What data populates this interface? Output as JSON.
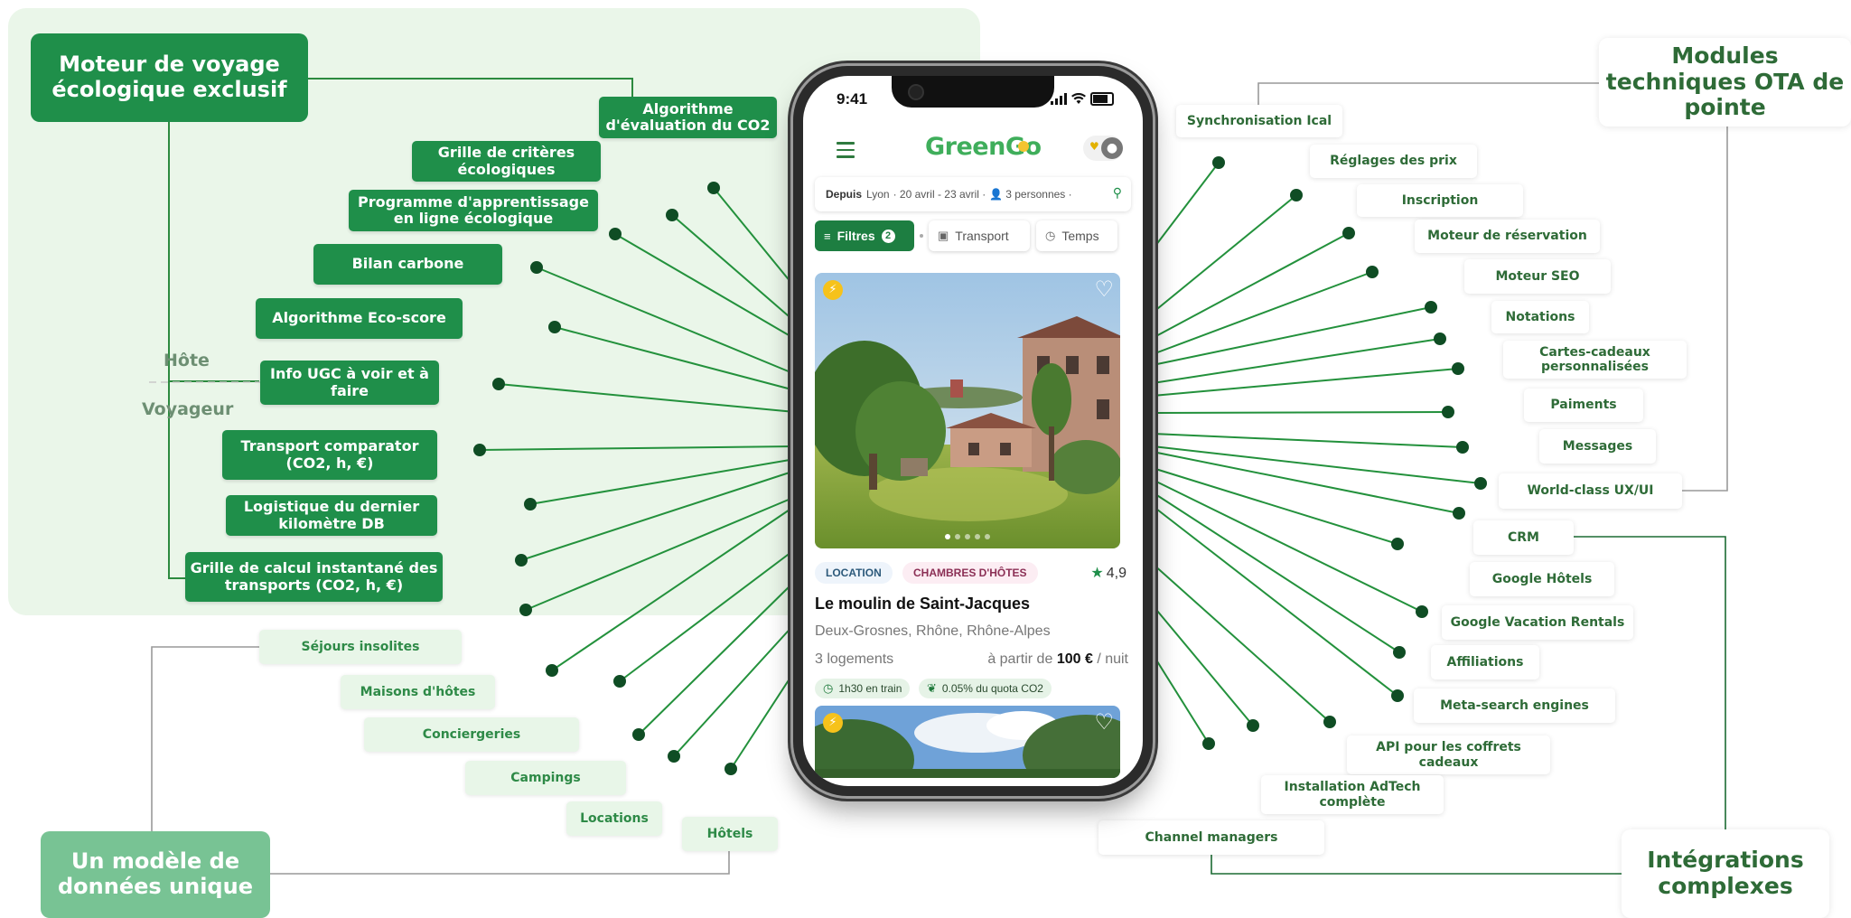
{
  "left": {
    "title": "Moteur de voyage écologique exclusif",
    "axis_host": "Hôte",
    "axis_traveler": "Voyageur",
    "items": [
      "Algorithme d'évaluation du CO2",
      "Grille de critères écologiques",
      "Programme d'apprentissage en ligne écologique",
      "Bilan carbone",
      "Algorithme Eco-score",
      "Info UGC à voir et à faire",
      "Transport comparator (CO2, h, €)",
      "Logistique du dernier kilomètre DB",
      "Grille de calcul instantané des transports (CO2, h, €)"
    ]
  },
  "bottom_left": {
    "title": "Un modèle de données unique",
    "items": [
      "Séjours insolites",
      "Maisons d'hôtes",
      "Conciergeries",
      "Campings",
      "Locations",
      "Hôtels"
    ]
  },
  "right_top": {
    "title": "Modules techniques OTA de pointe",
    "items": [
      "Synchronisation Ical",
      "Réglages des prix",
      "Inscription",
      "Moteur de réservation",
      "Moteur SEO",
      "Notations",
      "Cartes-cadeaux personnalisées",
      "Paiments",
      "Messages",
      "World-class UX/UI"
    ]
  },
  "right_bottom": {
    "title": "Intégrations complexes",
    "items": [
      "CRM",
      "Google Hôtels",
      "Google Vacation Rentals",
      "Affiliations",
      "Meta-search engines",
      "API pour les coffrets cadeaux",
      "Installation AdTech complète",
      "Channel managers"
    ]
  },
  "phone": {
    "time": "9:41",
    "logo": "GreenGo",
    "search": {
      "label": "Depuis",
      "from": "Lyon",
      "dates": "· 20 avril - 23 avril ·",
      "guests": "3 personnes ·"
    },
    "filters": {
      "main": "Filtres",
      "count": "2",
      "transport": "Transport",
      "temps": "Temps"
    },
    "card": {
      "tag1": "LOCATION",
      "tag2": "CHAMBRES D'HÔTES",
      "rating": "4,9",
      "title": "Le moulin de Saint-Jacques",
      "location": "Deux-Grosnes, Rhône, Rhône-Alpes",
      "units": "3 logements",
      "price_prefix": "à partir de",
      "price": "100 €",
      "price_suffix": "/ nuit",
      "chip_train": "1h30 en train",
      "chip_co2": "0.05% du quota CO2"
    }
  },
  "colors": {
    "dark_green": "#1f8f4a",
    "light_green": "#78c394",
    "panel_bg": "#eaf6e9",
    "wire_dot": "#0f4d24",
    "wire_line": "#23913c"
  }
}
